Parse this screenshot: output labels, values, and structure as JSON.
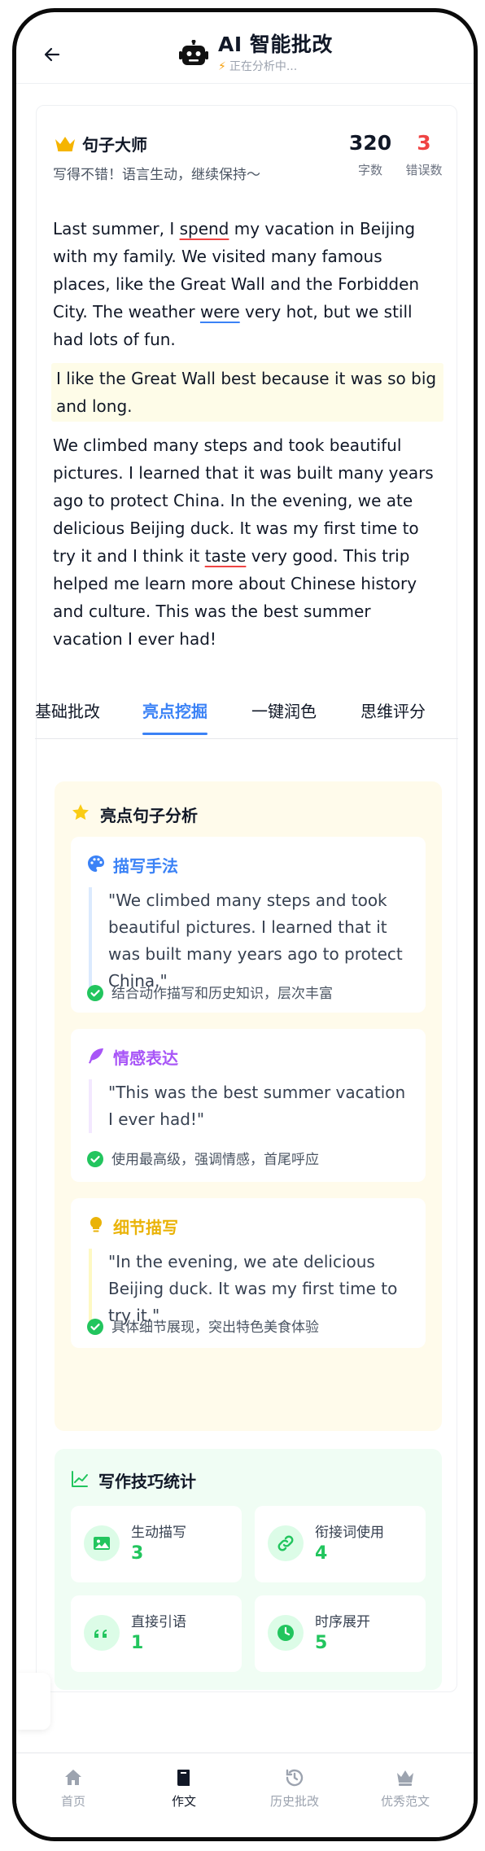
{
  "header": {
    "title": "AI 智能批改",
    "subtitle": "正在分析中..."
  },
  "summary": {
    "level": "句子大师",
    "comment": "写得不错！语言生动，继续保持～",
    "word_count": "320",
    "word_count_label": "字数",
    "error_count": "3",
    "error_count_label": "错误数"
  },
  "essay": {
    "p1_a": "Last summer, I ",
    "p1_err1": "spend",
    "p1_b": " my vacation in Beijing with my family. We visited many famous places, like the Great Wall and the Forbidden City. The weather ",
    "p1_err2": "were",
    "p1_c": " very hot, but we still had lots of fun.",
    "p2": "I like the Great Wall best because it was so big and long.",
    "p3_a": "We climbed many steps and took beautiful pictures. I learned that it was built many years ago to protect China. In the evening, we ate delicious Beijing duck. It was my first time to try it and I think it ",
    "p3_err": "taste",
    "p3_b": " very good. This trip helped me learn more about Chinese history and culture. This was the best summer vacation I ever had!"
  },
  "tabs": [
    {
      "label": "基础批改",
      "active": false
    },
    {
      "label": "亮点挖掘",
      "active": true
    },
    {
      "label": "一键润色",
      "active": false
    },
    {
      "label": "思维评分",
      "active": false
    }
  ],
  "highlights": {
    "title": "亮点句子分析",
    "items": [
      {
        "title": "描写手法",
        "color": "#3b82f6",
        "quote": "\"We climbed many steps and took beautiful pictures. I learned that it was built many years ago to protect China.\"",
        "note": "结合动作描写和历史知识，层次丰富"
      },
      {
        "title": "情感表达",
        "color": "#a855f7",
        "quote": "\"This was the best summer vacation I ever had!\"",
        "note": "使用最高级，强调情感，首尾呼应"
      },
      {
        "title": "细节描写",
        "color": "#eab308",
        "quote": "\"In the evening, we ate delicious Beijing duck. It was my first time to try it.\"",
        "note": "具体细节展现，突出特色美食体验"
      }
    ]
  },
  "skills": {
    "title": "写作技巧统计",
    "items": [
      {
        "label": "生动描写",
        "value": "3",
        "icon": "image-icon"
      },
      {
        "label": "衔接词使用",
        "value": "4",
        "icon": "link-icon"
      },
      {
        "label": "直接引语",
        "value": "1",
        "icon": "quote-icon"
      },
      {
        "label": "时序展开",
        "value": "5",
        "icon": "clock-icon"
      }
    ]
  },
  "nav": [
    {
      "label": "首页",
      "icon": "home-icon",
      "active": false
    },
    {
      "label": "作文",
      "icon": "book-icon",
      "active": true
    },
    {
      "label": "历史批改",
      "icon": "history-icon",
      "active": false
    },
    {
      "label": "优秀范文",
      "icon": "crown-icon",
      "active": false
    }
  ]
}
